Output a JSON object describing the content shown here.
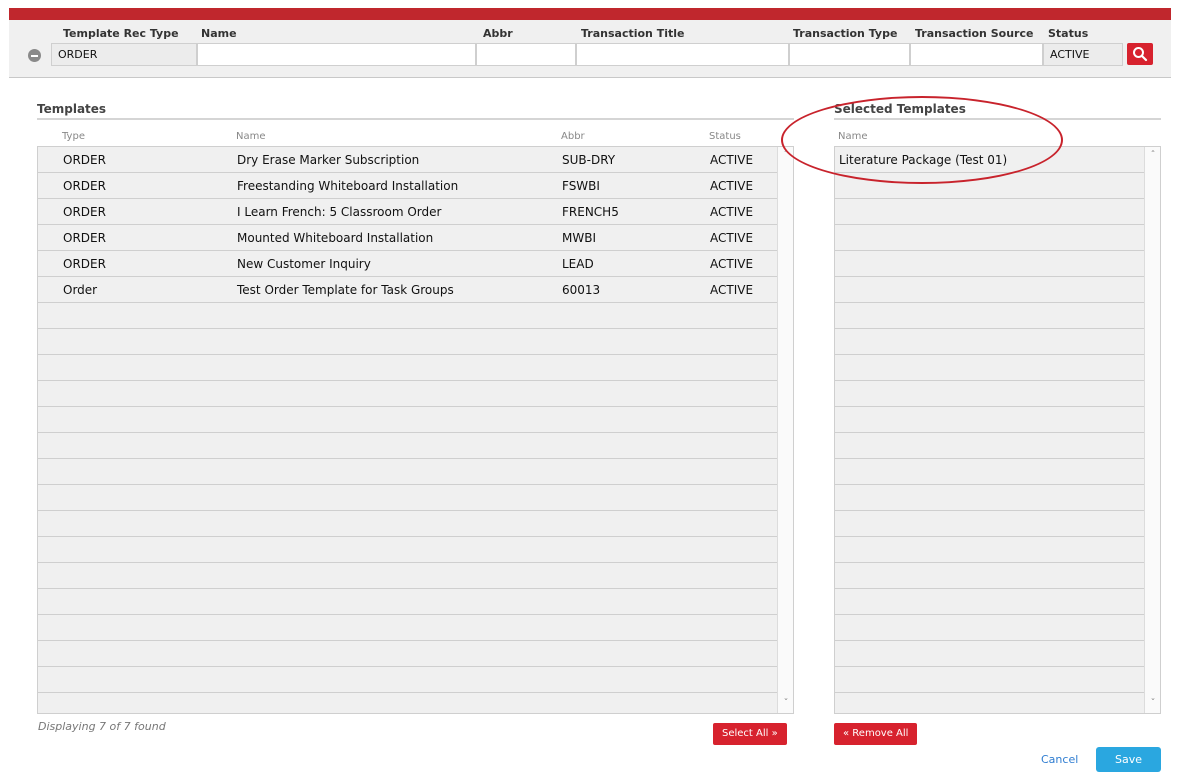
{
  "filter": {
    "labels": {
      "template_rec_type": "Template Rec Type",
      "name": "Name",
      "abbr": "Abbr",
      "transaction_title": "Transaction Title",
      "transaction_type": "Transaction Type",
      "transaction_source": "Transaction Source",
      "status": "Status"
    },
    "values": {
      "template_rec_type": "ORDER",
      "name": "",
      "abbr": "",
      "transaction_title": "",
      "transaction_type": "",
      "transaction_source": "",
      "status": "ACTIVE"
    },
    "icons": {
      "collapse": "minus-circle-icon",
      "search": "search-icon"
    }
  },
  "templates": {
    "heading": "Templates",
    "columns": [
      "Type",
      "Name",
      "Abbr",
      "Status"
    ],
    "rows": [
      [
        "ORDER",
        "Dry Erase Marker Subscription",
        "SUB-DRY",
        "ACTIVE"
      ],
      [
        "ORDER",
        "Freestanding Whiteboard Installation",
        "FSWBI",
        "ACTIVE"
      ],
      [
        "ORDER",
        "I Learn French: 5 Classroom Order",
        "FRENCH5",
        "ACTIVE"
      ],
      [
        "ORDER",
        "Mounted Whiteboard Installation",
        "MWBI",
        "ACTIVE"
      ],
      [
        "ORDER",
        "New Customer Inquiry",
        "LEAD",
        "ACTIVE"
      ],
      [
        "Order",
        "Test Order Template for Task Groups",
        "60013",
        "ACTIVE"
      ]
    ],
    "footer": "Displaying 7 of 7 found"
  },
  "selected": {
    "heading": "Selected Templates",
    "columns": [
      "Name"
    ],
    "rows": [
      "Literature Package (Test 01)"
    ]
  },
  "actions": {
    "select_all": "Select All »",
    "remove_all": "« Remove All",
    "cancel": "Cancel",
    "save": "Save"
  },
  "colors": {
    "brand_red": "#d7222e",
    "save_blue": "#2aa7e0",
    "link_blue": "#2f7dd1"
  }
}
